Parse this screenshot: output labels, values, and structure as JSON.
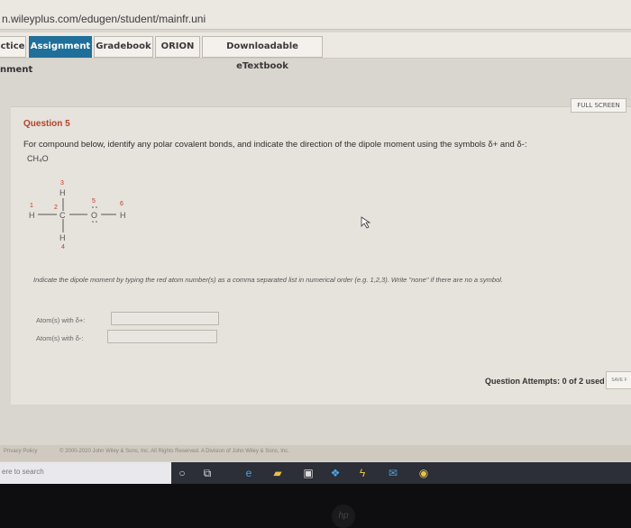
{
  "browser": {
    "url": "n.wileyplus.com/edugen/student/mainfr.uni"
  },
  "tabs": [
    {
      "label": "ctice"
    },
    {
      "label": "Assignment",
      "active": true
    },
    {
      "label": "Gradebook"
    },
    {
      "label": "ORION"
    },
    {
      "label": "Downloadable eTextbook"
    }
  ],
  "section_label": "nment",
  "full_screen_label": "FULL SCREEN",
  "question": {
    "title": "Question 5",
    "prompt": "For compound below, identify any polar covalent bonds, and indicate the direction of the dipole moment using the symbols δ+ and δ-:",
    "formula": "CH₄O"
  },
  "molecule": {
    "atoms": [
      {
        "symbol": "H",
        "num": "1"
      },
      {
        "symbol": "C",
        "num": "2"
      },
      {
        "symbol": "H",
        "num": "3"
      },
      {
        "symbol": "H",
        "num": "4"
      },
      {
        "symbol": "O",
        "num": "5"
      },
      {
        "symbol": "H",
        "num": "6"
      }
    ]
  },
  "instructions": "Indicate the dipole moment by typing the red atom number(s) as a comma separated list in numerical order (e.g. 1,2,3). Write \"none\" if there are no a symbol.",
  "fields": [
    {
      "label": "Atom(s) with δ+:",
      "value": ""
    },
    {
      "label": "Atom(s) with δ-:",
      "value": ""
    }
  ],
  "attempts": "Question Attempts: 0 of 2 used",
  "save_label": "SAVE F",
  "footer": {
    "privacy": "Privacy Policy",
    "copyright": "© 2000-2020 John Wiley & Sons, Inc. All Rights Reserved. A Division of John Wiley & Sons, Inc."
  },
  "taskbar": {
    "search_placeholder": "ere to search",
    "icons": [
      "circle-icon",
      "task-view-icon",
      "edge-icon",
      "file-explorer-icon",
      "store-icon",
      "dropbox-icon",
      "power-icon",
      "mail-icon",
      "chrome-icon"
    ]
  },
  "brand": "hp"
}
